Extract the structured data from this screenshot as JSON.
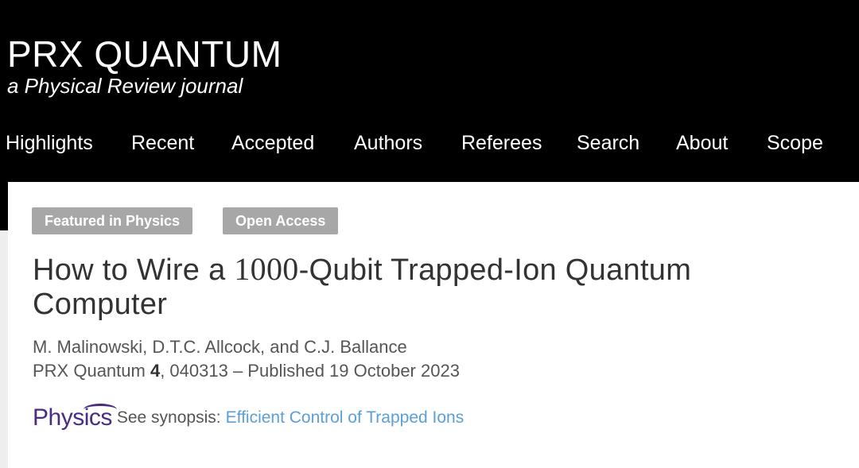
{
  "brand": {
    "title": "PRX QUANTUM",
    "subtitle": "a Physical Review journal"
  },
  "nav": {
    "items": [
      "Highlights",
      "Recent",
      "Accepted",
      "Authors",
      "Referees",
      "Search",
      "About",
      "Scope"
    ]
  },
  "article": {
    "badges": [
      "Featured in Physics",
      "Open Access"
    ],
    "title_pre": "How to Wire a ",
    "title_number": "1000",
    "title_post": "-Qubit Trapped-Ion Quantum Computer",
    "authors": "M. Malinowski, D.T.C. Allcock, and C.J. Ballance",
    "journal": "PRX Quantum ",
    "volume": "4",
    "citation_rest": ", 040313 – Published 19 October 2023"
  },
  "synopsis": {
    "logo_text": "Physics",
    "label": "See synopsis:",
    "link_text": "Efficient Control of Trapped Ions"
  },
  "colors": {
    "header_bg": "#000000",
    "badge_bg": "#a7a7a7",
    "physics_purple": "#4a2c82",
    "link_blue": "#5b9fd6"
  }
}
